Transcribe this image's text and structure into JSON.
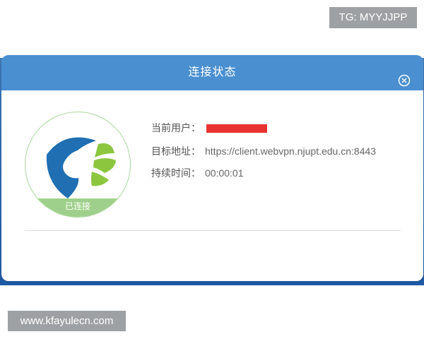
{
  "watermarks": {
    "top_right": "TG: MYYJJPP",
    "bottom_left": "www.kfayulecn.com"
  },
  "dialog": {
    "title": "连接状态",
    "close_icon": "close-circle-icon",
    "status_badge": "已连接",
    "fields": [
      {
        "label": "当前用户：",
        "value": ""
      },
      {
        "label": "目标地址：",
        "value": "https://client.webvpn.njupt.edu.cn:8443"
      },
      {
        "label": "持续时间：",
        "value": "00:00:01"
      }
    ]
  },
  "colors": {
    "header": "#4a8fd0",
    "logo_blue": "#1f6fb2",
    "logo_green": "#8cc63f",
    "status_green": "#9fd08b",
    "redaction": "#e8322f"
  }
}
